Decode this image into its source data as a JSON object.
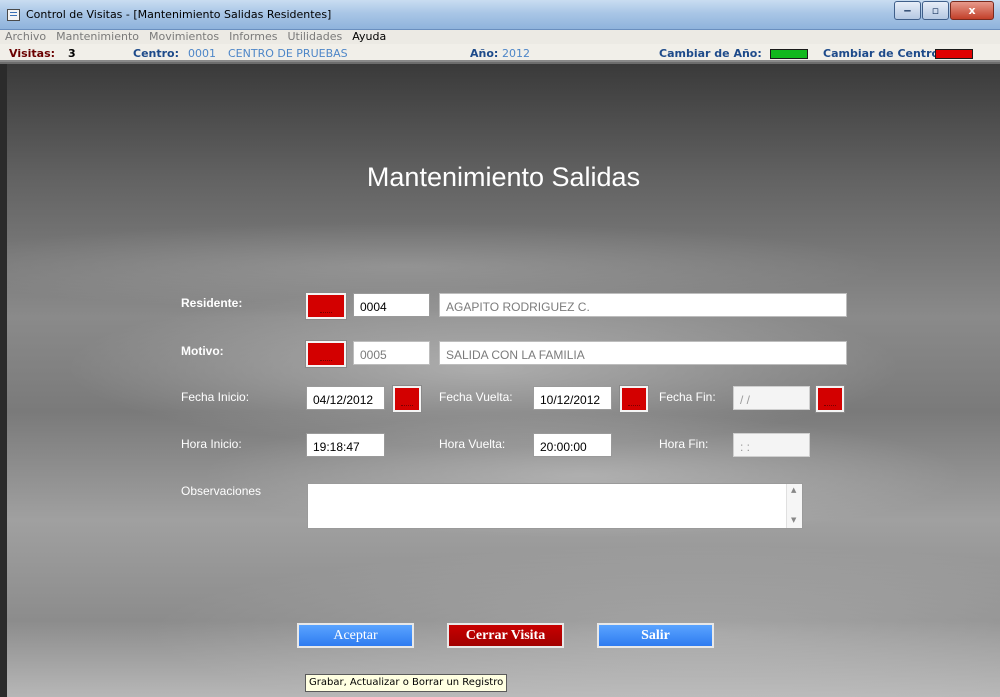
{
  "window": {
    "title": "Control de Visitas - [Mantenimiento Salidas Residentes]",
    "minimize": "‒",
    "maximize": "▫",
    "close": "x"
  },
  "menu": [
    {
      "label": "Archivo",
      "enabled": false
    },
    {
      "label": "Mantenimiento",
      "enabled": false
    },
    {
      "label": "Movimientos",
      "enabled": false
    },
    {
      "label": "Informes",
      "enabled": false
    },
    {
      "label": "Utilidades",
      "enabled": false
    },
    {
      "label": "Ayuda",
      "enabled": true
    }
  ],
  "status": {
    "visitas_label": "Visitas:",
    "visitas_value": "3",
    "centro_label": "Centro:",
    "centro_code": "0001",
    "centro_name": "CENTRO DE PRUEBAS",
    "anio_label": "Año:",
    "anio_value": "2012",
    "cambiar_anio_label": "Cambiar de Año:",
    "cambiar_centro_label": "Cambiar de Centro:",
    "colors": {
      "cambiar_anio": "#11b81d",
      "cambiar_centro": "#e00000"
    }
  },
  "form": {
    "title": "Mantenimiento Salidas",
    "residente": {
      "label": "Residente:",
      "code": "0004",
      "name": "AGAPITO RODRIGUEZ C."
    },
    "motivo": {
      "label": "Motivo:",
      "code": "0005",
      "name": "SALIDA CON LA FAMILIA"
    },
    "fecha_inicio": {
      "label": "Fecha Inicio:",
      "value": "04/12/2012"
    },
    "fecha_vuelta": {
      "label": "Fecha Vuelta:",
      "value": "10/12/2012"
    },
    "fecha_fin": {
      "label": "Fecha Fin:",
      "value": " /  /"
    },
    "hora_inicio": {
      "label": "Hora Inicio:",
      "value": "19:18:47"
    },
    "hora_vuelta": {
      "label": "Hora Vuelta:",
      "value": "20:00:00"
    },
    "hora_fin": {
      "label": "Hora Fin:",
      "value": " :  :"
    },
    "observaciones": {
      "label": "Observaciones",
      "value": ""
    }
  },
  "buttons": {
    "aceptar": "Aceptar",
    "cerrar_visita": "Cerrar Visita",
    "salir": "Salir"
  },
  "tooltip": "Grabar, Actualizar o Borrar un Registro"
}
